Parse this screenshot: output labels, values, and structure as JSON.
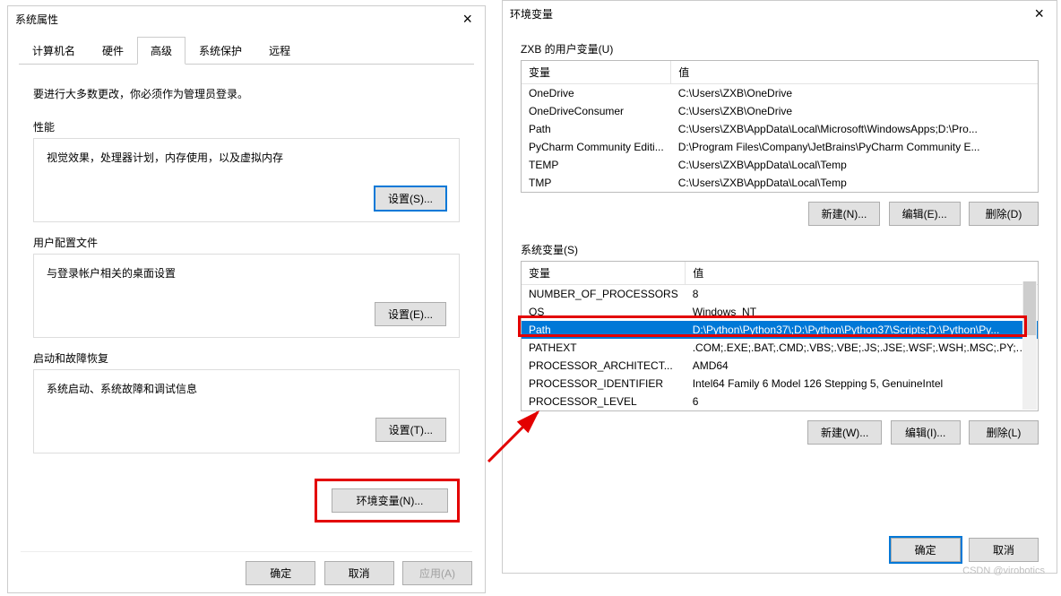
{
  "dlg1": {
    "title": "系统属性",
    "tabs": [
      "计算机名",
      "硬件",
      "高级",
      "系统保护",
      "远程"
    ],
    "intro": "要进行大多数更改，你必须作为管理员登录。",
    "groups": {
      "perf": {
        "title": "性能",
        "desc": "视觉效果，处理器计划，内存使用，以及虚拟内存",
        "btn": "设置(S)..."
      },
      "profile": {
        "title": "用户配置文件",
        "desc": "与登录帐户相关的桌面设置",
        "btn": "设置(E)..."
      },
      "startup": {
        "title": "启动和故障恢复",
        "desc": "系统启动、系统故障和调试信息",
        "btn": "设置(T)..."
      }
    },
    "env_btn": "环境变量(N)...",
    "bottom": {
      "ok": "确定",
      "cancel": "取消",
      "apply": "应用(A)"
    }
  },
  "dlg2": {
    "title": "环境变量",
    "user_section": "ZXB 的用户变量(U)",
    "sys_section": "系统变量(S)",
    "headers": {
      "var": "变量",
      "val": "值"
    },
    "user_rows": [
      {
        "var": "OneDrive",
        "val": "C:\\Users\\ZXB\\OneDrive"
      },
      {
        "var": "OneDriveConsumer",
        "val": "C:\\Users\\ZXB\\OneDrive"
      },
      {
        "var": "Path",
        "val": "C:\\Users\\ZXB\\AppData\\Local\\Microsoft\\WindowsApps;D:\\Pro..."
      },
      {
        "var": "PyCharm Community Editi...",
        "val": "D:\\Program Files\\Company\\JetBrains\\PyCharm Community E..."
      },
      {
        "var": "TEMP",
        "val": "C:\\Users\\ZXB\\AppData\\Local\\Temp"
      },
      {
        "var": "TMP",
        "val": "C:\\Users\\ZXB\\AppData\\Local\\Temp"
      }
    ],
    "sys_rows": [
      {
        "var": "NUMBER_OF_PROCESSORS",
        "val": "8"
      },
      {
        "var": "OS",
        "val": "Windows_NT"
      },
      {
        "var": "Path",
        "val": "D:\\Python\\Python37\\;D:\\Python\\Python37\\Scripts;D:\\Python\\Py..."
      },
      {
        "var": "PATHEXT",
        "val": ".COM;.EXE;.BAT;.CMD;.VBS;.VBE;.JS;.JSE;.WSF;.WSH;.MSC;.PY;.P..."
      },
      {
        "var": "PROCESSOR_ARCHITECT...",
        "val": "AMD64"
      },
      {
        "var": "PROCESSOR_IDENTIFIER",
        "val": "Intel64 Family 6 Model 126 Stepping 5, GenuineIntel"
      },
      {
        "var": "PROCESSOR_LEVEL",
        "val": "6"
      }
    ],
    "buttons": {
      "new": "新建(N)...",
      "new2": "新建(W)...",
      "edit": "编辑(E)...",
      "edit2": "编辑(I)...",
      "del": "删除(D)",
      "del2": "删除(L)",
      "ok": "确定",
      "cancel": "取消"
    }
  },
  "watermark": "CSDN @virobotics"
}
